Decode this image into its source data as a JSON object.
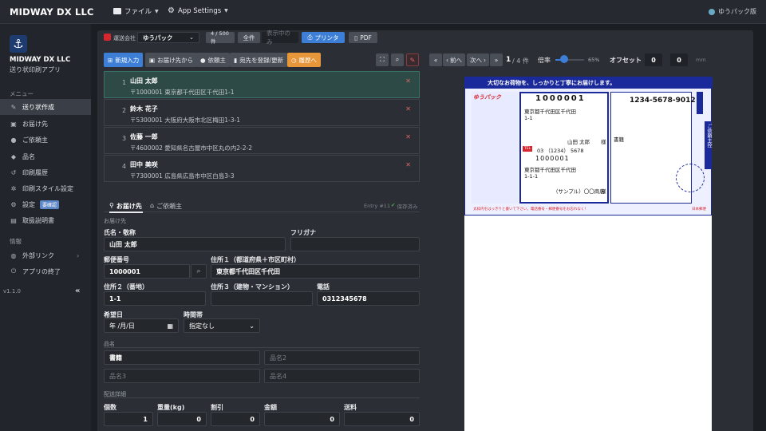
{
  "topbar": {
    "brand": "MIDWAY DX LLC",
    "file_menu": "ファイル",
    "settings_menu": "App Settings",
    "edition": "ゆうパック版"
  },
  "sidebar": {
    "app_name": "MIDWAY DX LLC",
    "app_sub": "送り状印刷アプリ",
    "menu_heading": "メニュー",
    "items": [
      {
        "label": "送り状作成",
        "icon": "pen-icon"
      },
      {
        "label": "お届け先",
        "icon": "address-card-icon"
      },
      {
        "label": "ご依頼主",
        "icon": "user-icon"
      },
      {
        "label": "品名",
        "icon": "tag-icon"
      },
      {
        "label": "印刷履歴",
        "icon": "history-icon"
      },
      {
        "label": "印刷スタイル設定",
        "icon": "settings-icon"
      },
      {
        "label": "設定",
        "icon": "gear-icon",
        "badge": "要確認"
      },
      {
        "label": "取扱説明書",
        "icon": "manual-icon"
      }
    ],
    "info_heading": "情報",
    "info_items": [
      {
        "label": "外部リンク",
        "icon": "globe-icon"
      },
      {
        "label": "アプリの終了",
        "icon": "power-icon"
      }
    ],
    "version": "v1.1.0"
  },
  "toolbar": {
    "carrier_label": "運送会社",
    "carrier_value": "ゆうパック",
    "count": "4 / 500 件",
    "all_label": "全件",
    "showing_label": "表示中のみ",
    "print_label": "プリンタ",
    "pdf_label": "PDF"
  },
  "actions": {
    "new": "新規入力",
    "from_dest": "お届け先から",
    "from_client": "依頼主",
    "register": "宛先を登録/更新",
    "history": "履歴へ"
  },
  "entries": [
    {
      "num": "1",
      "name": "山田 太郎",
      "address": "〒1000001  東京都千代田区千代田1-1"
    },
    {
      "num": "2",
      "name": "鈴木 花子",
      "address": "〒5300001  大阪府大阪市北区梅田1-3-1"
    },
    {
      "num": "3",
      "name": "佐藤 一郎",
      "address": "〒4600002  愛知県名古屋市中区丸の内2-2-2"
    },
    {
      "num": "4",
      "name": "田中 美咲",
      "address": "〒7300001  広島県広島市中区白島3-3"
    }
  ],
  "form": {
    "tab_dest": "お届け先",
    "tab_client": "ご依頼主",
    "entry_id": "Entry #11",
    "saved": "保存済み",
    "section_dest": "お届け先",
    "name_label": "氏名・敬称",
    "name_value": "山田 太郎",
    "furigana_label": "フリガナ",
    "zip_label": "郵便番号",
    "zip_value": "1000001",
    "addr1_label": "住所１（都道府県＋市区町村）",
    "addr1_value": "東京都千代田区千代田",
    "addr2_label": "住所２（番地）",
    "addr2_value": "1-1",
    "addr3_label": "住所３（建物・マンション）",
    "phone_label": "電話",
    "phone_value": "0312345678",
    "date_label": "希望日",
    "date_value": "年 /月/日",
    "time_label": "時間帯",
    "time_value": "指定なし",
    "section_goods": "品名",
    "goods1": "書籍",
    "goods2_ph": "品名2",
    "goods3_ph": "品名3",
    "goods4_ph": "品名4",
    "section_detail": "配送詳細",
    "qty_label": "個数",
    "qty_value": "1",
    "weight_label": "重量(kg)",
    "weight_value": "0",
    "discount_label": "割引",
    "discount_value": "0",
    "amount_label": "金額",
    "amount_value": "0",
    "fee_label": "送料",
    "fee_value": "0"
  },
  "preview_nav": {
    "prev": "前へ",
    "next": "次へ",
    "page": "1",
    "page_total": "/ 4 件",
    "zoom_label": "倍率",
    "zoom_value": "65%",
    "zoom_level": 0.3,
    "offset_label": "オフセット",
    "offset_x": "0",
    "offset_y": "0",
    "unit": "mm"
  },
  "label": {
    "banner": "大切なお荷物を、しっかりと丁寧にお届けします。",
    "brand": "ゆうパック",
    "dest_zip": "1000001",
    "dest_addr1": "東京都千代田区千代田",
    "dest_addr2": "1-1",
    "dest_name": "山田 太郎",
    "honorific": "様",
    "phone": "03  （1234） 5678",
    "src_zip": "1000001",
    "src_addr1": "東京都千代田区千代田",
    "src_addr2": "1-1-1",
    "src_name": "（サンプル）〇〇商店",
    "tracking": "1234-5678-9012",
    "goods": "書籍",
    "side_text": "ご依頼主控",
    "footer": "太枠内をはっきりと書いて下さい。電話番号・郵便番号をお忘れなく！",
    "jp": "日本郵便"
  }
}
